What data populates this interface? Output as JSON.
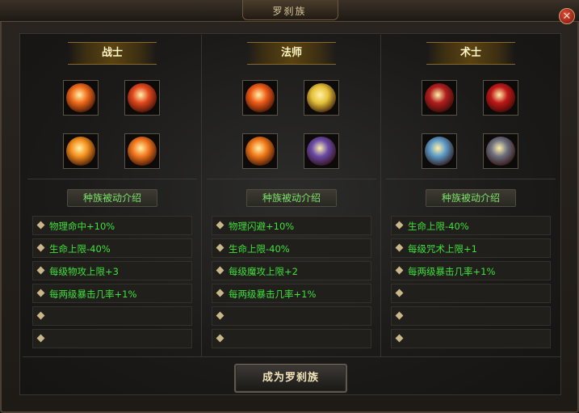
{
  "window": {
    "title": "罗刹族",
    "close_label": "✕"
  },
  "classes": [
    {
      "name": "战士",
      "skill_icons": [
        "slash-fire-icon",
        "flame-swirl-icon",
        "fire-tornado-icon",
        "fire-burst-icon"
      ],
      "skill_colors": [
        "#f06a1a",
        "#e2471c",
        "#f5901e",
        "#f3761d"
      ],
      "passive_button": "种族被动介绍",
      "stats": [
        "物理命中+10%",
        "生命上限-40%",
        "每级物攻上限+3",
        "每两级暴击几率+1%",
        "",
        ""
      ]
    },
    {
      "name": "法师",
      "skill_icons": [
        "fire-vortex-icon",
        "holy-shield-icon",
        "fire-wall-icon",
        "dark-spirit-icon"
      ],
      "skill_colors": [
        "#ee5a16",
        "#e6c23a",
        "#f07818",
        "#6a4aa8"
      ],
      "passive_button": "种族被动介绍",
      "stats": [
        "物理闪避+10%",
        "生命上限-40%",
        "每级魔攻上限+2",
        "每两级暴击几率+1%",
        "",
        ""
      ]
    },
    {
      "name": "术士",
      "skill_icons": [
        "blood-claw-icon",
        "demon-face-icon",
        "ice-blade-icon",
        "shadow-cloak-icon"
      ],
      "skill_colors": [
        "#b11e1e",
        "#c01818",
        "#5b9ac8",
        "#6d6f80"
      ],
      "passive_button": "种族被动介绍",
      "stats": [
        "生命上限-40%",
        "每级咒术上限+1",
        "每两级暴击几率+1%",
        "",
        "",
        ""
      ]
    }
  ],
  "action": {
    "become_label": "成为罗刹族"
  }
}
